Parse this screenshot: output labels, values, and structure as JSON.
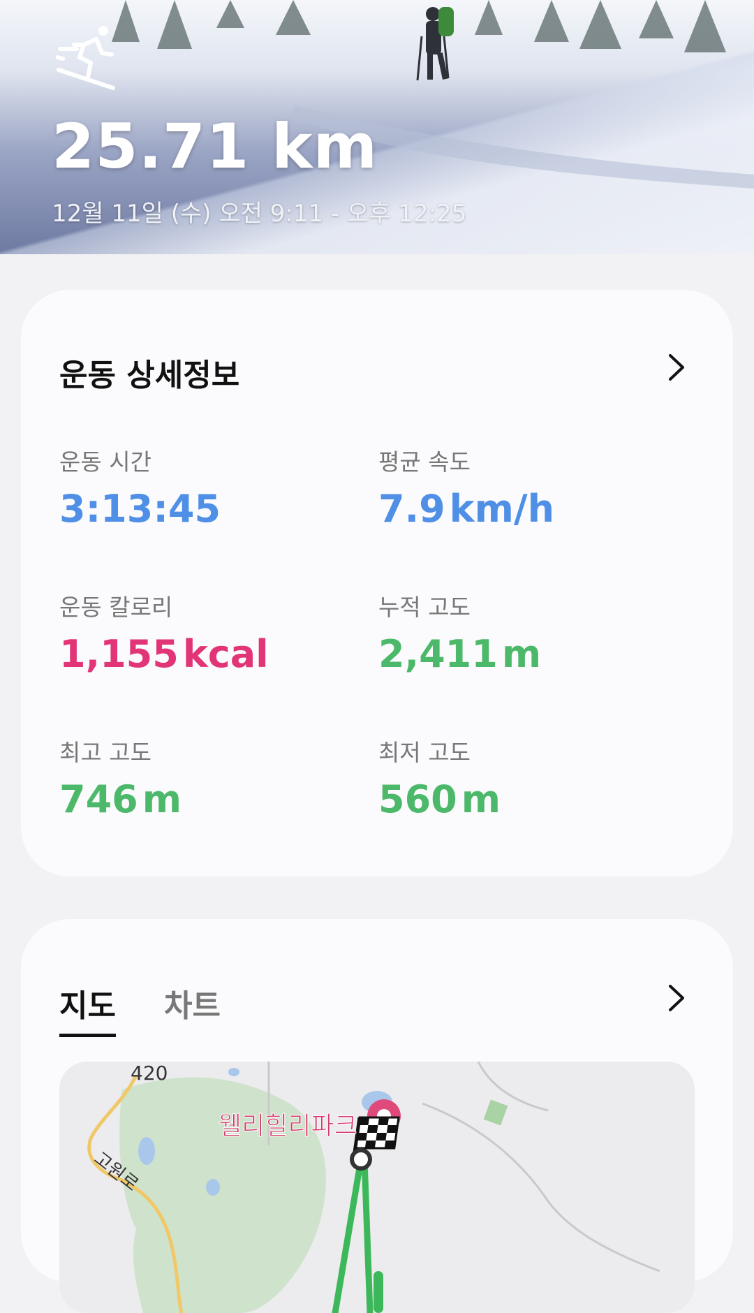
{
  "header": {
    "activity_icon": "skiing-icon",
    "distance": "25.71 km",
    "date_range": "12월 11일 (수) 오전 9:11 - 오후 12:25"
  },
  "details": {
    "title": "운동 상세정보",
    "chevron_icon": "chevron-right-icon",
    "stats": [
      {
        "label": "운동 시간",
        "value": "3:13:45",
        "unit": "",
        "color": "#4f8fe6"
      },
      {
        "label": "평균 속도",
        "value": "7.9",
        "unit": "km/h",
        "color": "#4f8fe6"
      },
      {
        "label": "운동 칼로리",
        "value": "1,155",
        "unit": "kcal",
        "color": "#e23577"
      },
      {
        "label": "누적 고도",
        "value": "2,411",
        "unit": "m",
        "color": "#4cb86a"
      },
      {
        "label": "최고 고도",
        "value": "746",
        "unit": "m",
        "color": "#4cb86a"
      },
      {
        "label": "최저 고도",
        "value": "560",
        "unit": "m",
        "color": "#4cb86a"
      }
    ]
  },
  "map_card": {
    "tabs": [
      "지도",
      "차트"
    ],
    "active_tab": "지도",
    "chevron_icon": "chevron-right-icon",
    "map": {
      "road_number": "420",
      "road_name": "고원로",
      "poi_name": "웰리힐리파크",
      "finish_icon": "checkered-flag-icon",
      "route_color": "#3cb85a"
    }
  }
}
